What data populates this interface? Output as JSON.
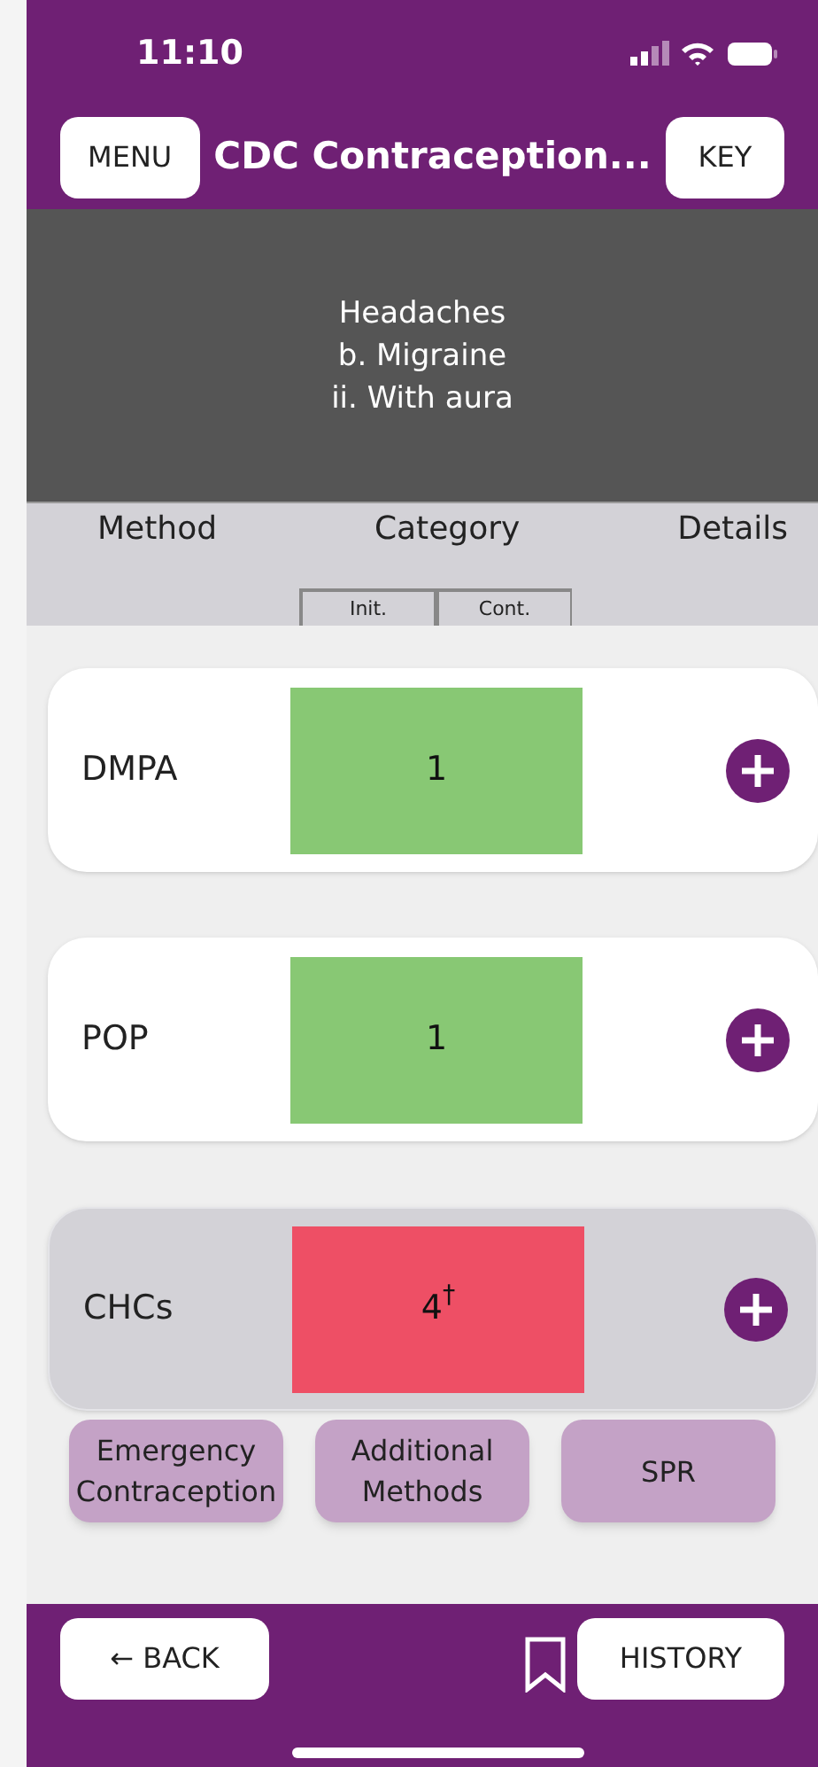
{
  "status_bar": {
    "time": "11:10"
  },
  "header": {
    "menu_button": "MENU",
    "title": "CDC Contraception...",
    "key_button": "KEY"
  },
  "condition": [
    "Headaches",
    "b. Migraine",
    "ii. With aura"
  ],
  "columns": {
    "method": "Method",
    "category": "Category",
    "details": "Details",
    "sub": [
      "Init.",
      "Cont."
    ]
  },
  "rows": [
    {
      "method": "DMPA",
      "category": "1",
      "color": "#88c874",
      "highlighted": false
    },
    {
      "method": "POP",
      "category": "1",
      "color": "#88c874",
      "highlighted": false
    },
    {
      "method": "CHCs",
      "category": "4$^{†}$",
      "color": "#ee4f65",
      "highlighted": true
    }
  ],
  "links": [
    "Emergency Contraception",
    "Additional Methods",
    "SPR"
  ],
  "footer": {
    "back_button": "← BACK",
    "history_button": "HISTORY"
  }
}
